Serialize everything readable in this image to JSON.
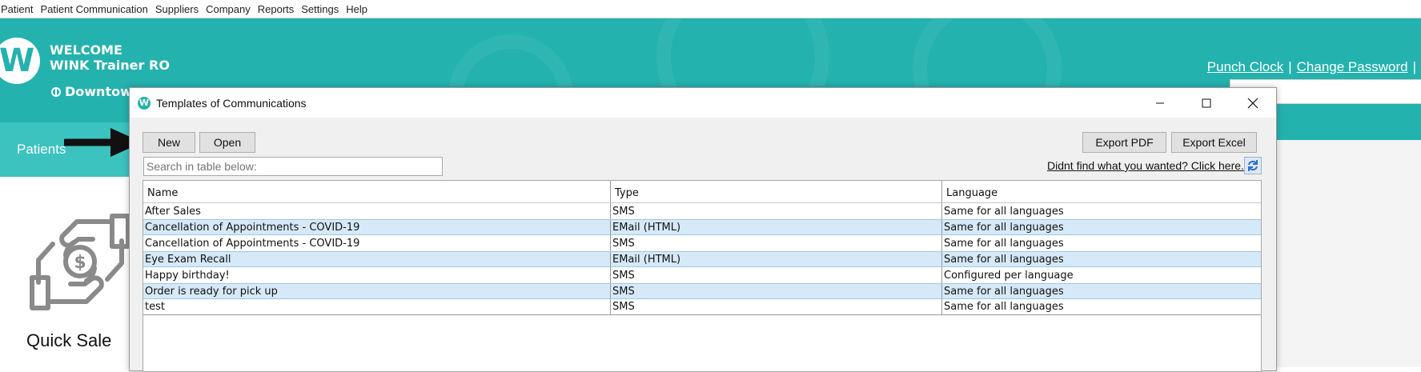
{
  "menu": [
    "Patient",
    "Patient Communication",
    "Suppliers",
    "Company",
    "Reports",
    "Settings",
    "Help"
  ],
  "header": {
    "logo_letter": "W",
    "welcome_line1": "WELCOME",
    "welcome_line2": "WINK Trainer RO",
    "location": "Downtow",
    "punch_clock": "Punch Clock",
    "change_password": "Change Password",
    "separator": "|"
  },
  "nav": {
    "patients": "Patients"
  },
  "quick_sale": {
    "label": "Quick Sale"
  },
  "dialog": {
    "title": "Templates of Communications",
    "icon_letter": "W",
    "buttons": {
      "new": "New",
      "open": "Open",
      "export_pdf": "Export PDF",
      "export_excel": "Export Excel"
    },
    "search_placeholder": "Search in table below:",
    "help_link": "Didnt find what you wanted? Click here.",
    "columns": [
      "Name",
      "Type",
      "Language"
    ],
    "rows": [
      [
        "After Sales",
        "SMS",
        "Same for all languages"
      ],
      [
        "Cancellation of Appointments - COVID-19",
        "EMail (HTML)",
        "Same for all languages"
      ],
      [
        "Cancellation of Appointments - COVID-19",
        "SMS",
        "Same for all languages"
      ],
      [
        "Eye Exam Recall",
        "EMail (HTML)",
        "Same for all languages"
      ],
      [
        "Happy birthday!",
        "SMS",
        "Configured per language"
      ],
      [
        "Order is ready for pick up",
        "SMS",
        "Same for all languages"
      ],
      [
        "test",
        "SMS",
        "Same for all languages"
      ]
    ]
  },
  "colors": {
    "teal": "#24b2ae",
    "row_highlight": "#d6e9f8"
  }
}
